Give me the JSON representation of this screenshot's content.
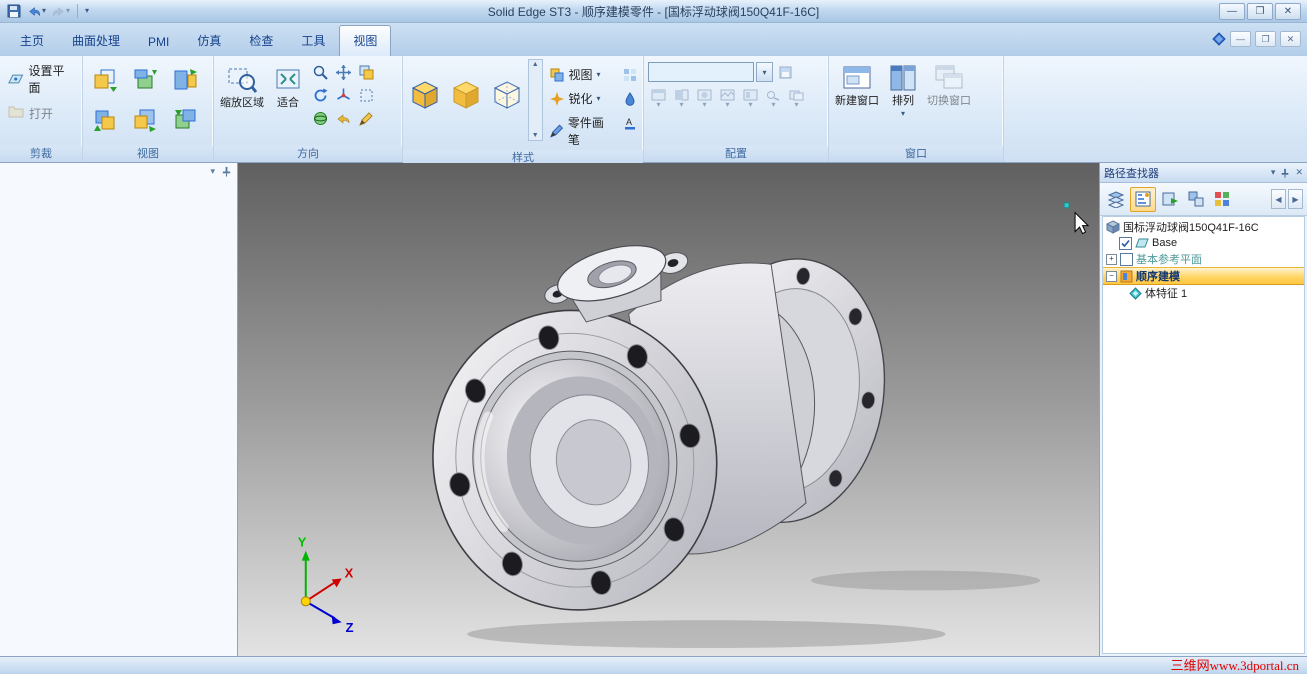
{
  "titlebar": {
    "title": "Solid Edge ST3 - 顺序建模零件 - [国标浮动球阀150Q41F-16C]"
  },
  "tabs": [
    "主页",
    "曲面处理",
    "PMI",
    "仿真",
    "检查",
    "工具",
    "视图"
  ],
  "ribbon": {
    "clip": {
      "label": "剪裁",
      "set_plane": "设置平面",
      "open": "打开"
    },
    "views": {
      "label": "视图"
    },
    "orientation": {
      "label": "方向",
      "zoom_area": "缩放区域",
      "fit": "适合"
    },
    "style": {
      "label": "样式",
      "view": "视图",
      "sharpen": "锐化",
      "part_painter": "零件画笔"
    },
    "configuration": {
      "label": "配置"
    },
    "window": {
      "label": "窗口",
      "new_window": "新建窗口",
      "arrange": "排列",
      "switch_window": "切换窗口"
    }
  },
  "pathfinder": {
    "title": "路径查找器",
    "tree": {
      "root": "国标浮动球阀150Q41F-16C",
      "base": "Base",
      "ref_planes": "基本参考平面",
      "ordered": "顺序建模",
      "feature": "体特征 1"
    }
  },
  "viewport": {
    "axis_x": "X",
    "axis_y": "Y",
    "axis_z": "Z"
  },
  "statusbar": {
    "watermark": "三维网www.3dportal.cn"
  },
  "colors": {
    "highlight_orange": "#ffcf5e",
    "watermark_red": "#e00000",
    "accent_blue": "#15428b"
  }
}
